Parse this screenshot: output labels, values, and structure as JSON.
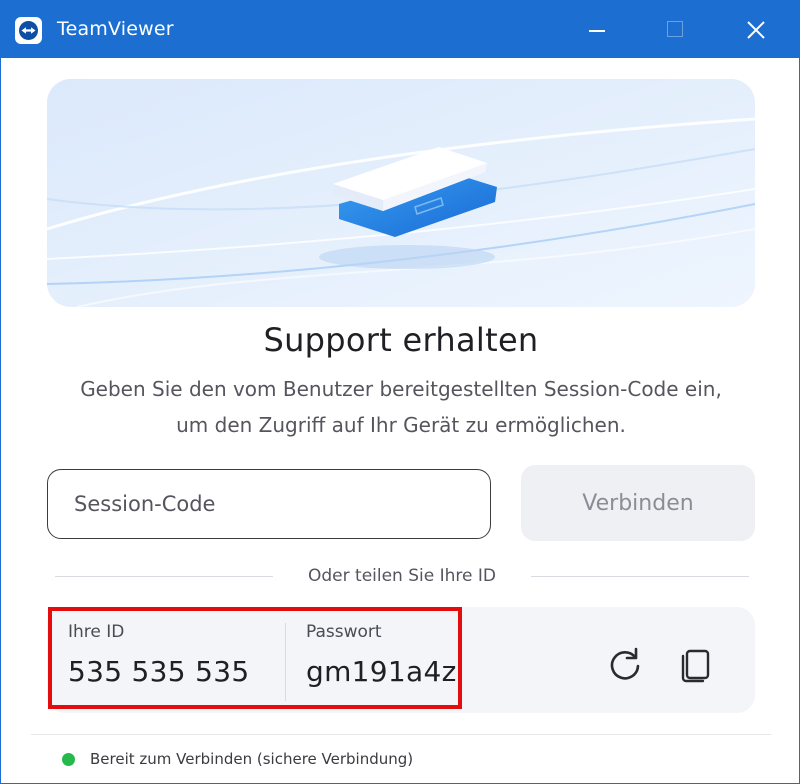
{
  "window": {
    "title": "TeamViewer",
    "accent_color": "#1c6fd0"
  },
  "main": {
    "heading": "Support erhalten",
    "description": "Geben Sie den vom Benutzer bereitgestellten Session-Code ein, um den Zugriff auf Ihr Gerät zu ermöglichen.",
    "session_placeholder": "Session-Code",
    "connect_label": "Verbinden",
    "divider_label": "Oder teilen Sie Ihre ID"
  },
  "credentials": {
    "id_label": "Ihre ID",
    "id_value": "535 535 535",
    "password_label": "Passwort",
    "password_value": "gm191a4z",
    "highlight_color": "#e30d0d"
  },
  "status": {
    "text": "Bereit zum Verbinden (sichere Verbindung)",
    "color": "#25b84a"
  },
  "icons": [
    "teamviewer-logo-icon",
    "minimize-icon",
    "maximize-icon",
    "close-icon",
    "refresh-icon",
    "copy-icon"
  ]
}
